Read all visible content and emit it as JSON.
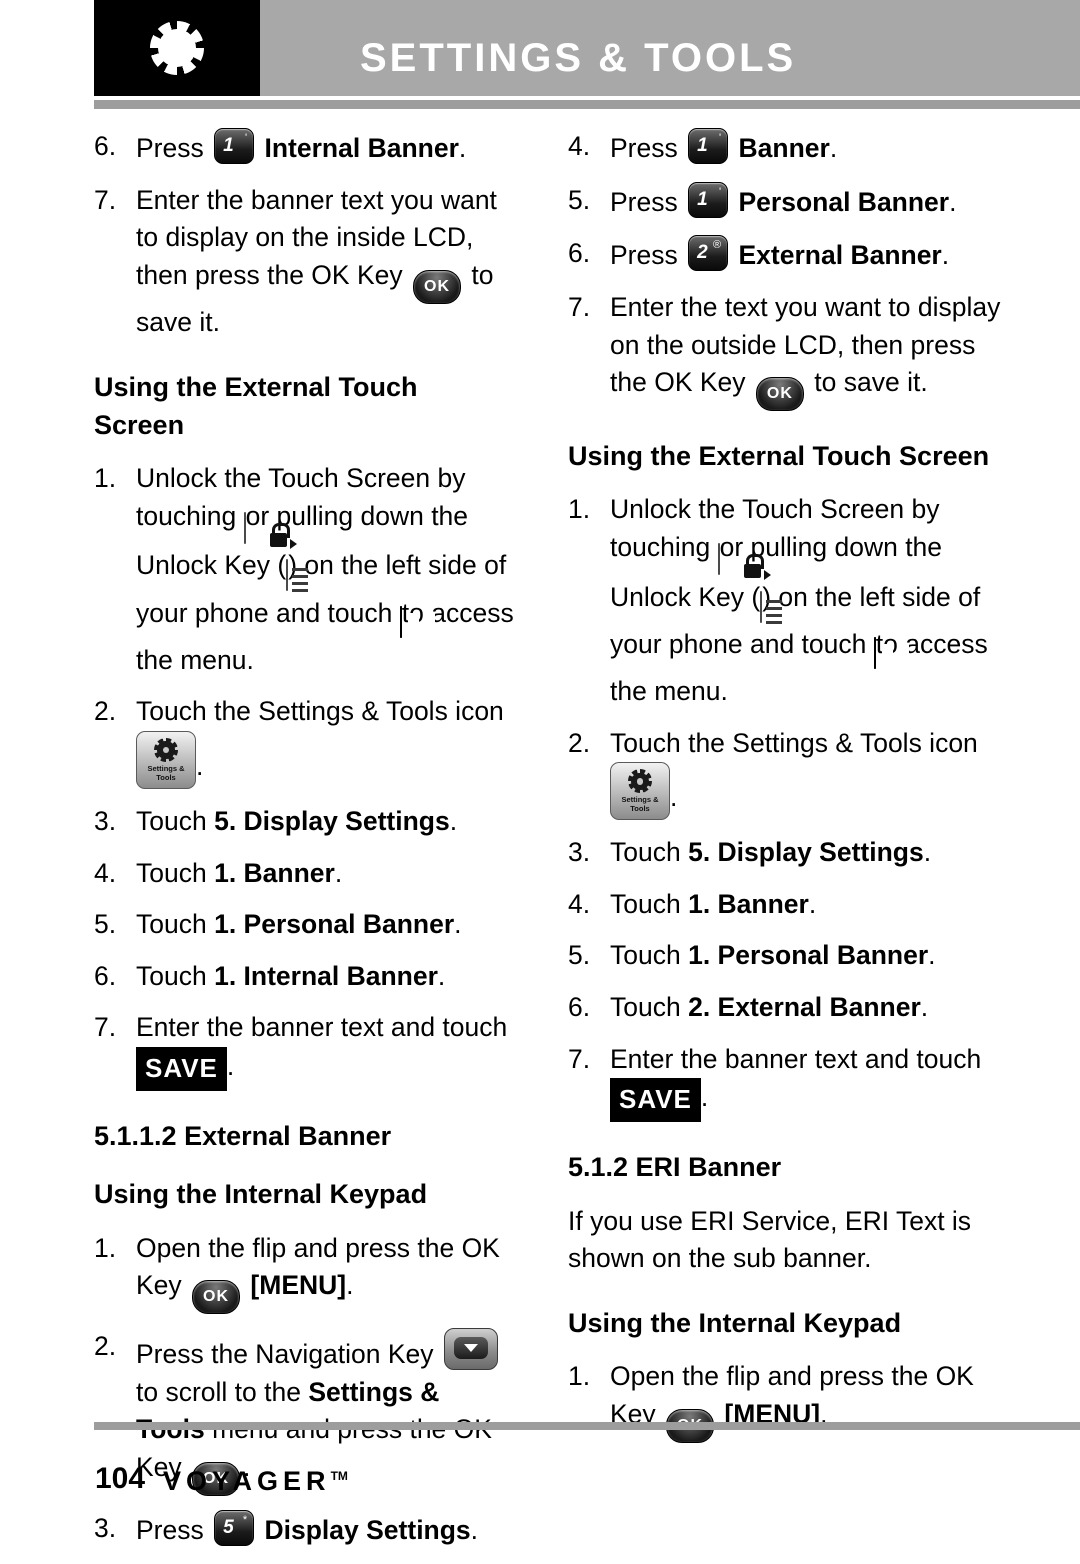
{
  "header": {
    "title": "SETTINGS & TOOLS",
    "icon": "gear-icon"
  },
  "left_column": {
    "items_top": [
      {
        "num": "6.",
        "pre": "Press",
        "key": "1",
        "post": "Internal Banner",
        "post_bold": true,
        "tail": "."
      },
      {
        "num": "7.",
        "text_1": "Enter the banner text you want to display on the inside LCD, then press the OK Key",
        "key": "OK",
        "text_2": "to save it."
      }
    ],
    "heading_touch": "Using the External Touch Screen",
    "touch_steps": {
      "s1_num": "1.",
      "s1_a": "Unlock the Touch Screen by touching",
      "s1_b": "or pulling down the Unlock Key (",
      "s1_c": ") on the left side of your phone and touch",
      "s1_d": "to access the menu.",
      "s2_num": "2.",
      "s2_a": "Touch the Settings & Tools icon",
      "s2_b": ".",
      "s3_num": "3.",
      "s3_a": "Touch ",
      "s3_b": "5. Display Settings",
      "s3_c": ".",
      "s4_num": "4.",
      "s4_a": "Touch ",
      "s4_b": "1. Banner",
      "s4_c": ".",
      "s5_num": "5.",
      "s5_a": "Touch ",
      "s5_b": "1. Personal Banner",
      "s5_c": ".",
      "s6_num": "6.",
      "s6_a": "Touch ",
      "s6_b": "1. Internal Banner",
      "s6_c": ".",
      "s7_num": "7.",
      "s7_a": "Enter the banner text and touch",
      "s7_save": "SAVE",
      "s7_c": "."
    },
    "section_heading": "5.1.1.2 External Banner",
    "keypad_heading": "Using the Internal Keypad",
    "keypad_steps": {
      "k1_num": "1.",
      "k1_a": "Open the flip and press the OK Key",
      "k1_b": "[MENU]",
      "k1_c": ".",
      "k2_num": "2.",
      "k2_a": "Press the Navigation Key",
      "k2_b": "to scroll to the ",
      "k2_bold": "Settings & Tools",
      "k2_c": " menu and press the OK Key",
      "k2_d": ".",
      "k3_num": "3.",
      "k3_a": "Press",
      "k3_key": "5",
      "k3_sup": "*",
      "k3_bold": "Display Settings",
      "k3_c": "."
    }
  },
  "right_column": {
    "items_top": [
      {
        "num": "4.",
        "pre": "Press",
        "key": "1",
        "sup": "'",
        "bold": "Banner",
        "tail": "."
      },
      {
        "num": "5.",
        "pre": "Press",
        "key": "1",
        "sup": "'",
        "bold": "Personal Banner",
        "tail": "."
      },
      {
        "num": "6.",
        "pre": "Press",
        "key": "2",
        "sup": "®",
        "bold": "External Banner",
        "tail": "."
      }
    ],
    "step7": {
      "num": "7.",
      "a": "Enter the text you want to display on the outside LCD, then press the OK Key",
      "b": "to save it."
    },
    "heading_touch": "Using the External Touch Screen",
    "touch_steps": {
      "s1_num": "1.",
      "s1_a": "Unlock the Touch Screen by touching",
      "s1_b": "or pulling down the Unlock Key (",
      "s1_c": ") on the left side of your phone and touch",
      "s1_d": "to access the menu.",
      "s2_num": "2.",
      "s2_a": "Touch the Settings & Tools icon",
      "s2_b": ".",
      "s3_num": "3.",
      "s3_a": "Touch ",
      "s3_b": "5. Display Settings",
      "s3_c": ".",
      "s4_num": "4.",
      "s4_a": "Touch ",
      "s4_b": "1. Banner",
      "s4_c": ".",
      "s5_num": "5.",
      "s5_a": "Touch ",
      "s5_b": "1. Personal Banner",
      "s5_c": ".",
      "s6_num": "6.",
      "s6_a": "Touch ",
      "s6_b": "2. External Banner",
      "s6_c": ".",
      "s7_num": "7.",
      "s7_a": "Enter the banner text and touch",
      "s7_save": "SAVE",
      "s7_c": "."
    },
    "eri_heading": "5.1.2 ERI Banner",
    "eri_text": "If you use ERI Service, ERI Text is shown on the sub banner.",
    "keypad_heading": "Using the Internal Keypad",
    "keypad_steps": {
      "k1_num": "1.",
      "k1_a": "Open the flip and press the OK Key",
      "k1_b": "[MENU]",
      "k1_c": "."
    }
  },
  "icons": {
    "ok_label": "OK",
    "settings_icon_line1": "Settings &",
    "settings_icon_line2": "Tools"
  },
  "footer": {
    "page": "104",
    "brand": "VOYAGER",
    "tm": "TM"
  }
}
